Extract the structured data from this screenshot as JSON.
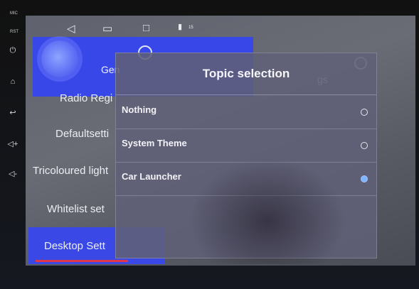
{
  "side_panel": {
    "labels": [
      "MIC",
      "RST"
    ]
  },
  "navbar": {
    "icons": [
      "back-icon",
      "home-icon",
      "recents-icon",
      "volume-icon"
    ],
    "volume_level": "15"
  },
  "header": {
    "tab_label": "Gen",
    "right_tab_label": "gs"
  },
  "settings_menu": {
    "items": [
      {
        "label": "Radio Regi"
      },
      {
        "label": "Defaultsetti"
      },
      {
        "label": "Tricoloured light"
      },
      {
        "label": "Whitelist set"
      },
      {
        "label": "Desktop Sett"
      }
    ],
    "selected_index": 4
  },
  "dialog": {
    "title": "Topic selection",
    "options": [
      {
        "label": "Nothing",
        "selected": false
      },
      {
        "label": "System Theme",
        "selected": false
      },
      {
        "label": "Car Launcher",
        "selected": true
      }
    ]
  },
  "colors": {
    "accent_blue": "#3a48e6",
    "selected_underline": "#e0384a",
    "radio_selected": "#7fb4ff"
  }
}
